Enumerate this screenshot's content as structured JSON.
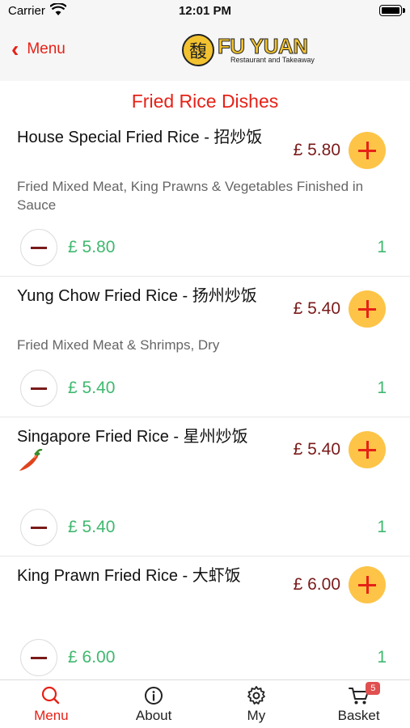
{
  "status_bar": {
    "carrier": "Carrier",
    "time": "12:01 PM"
  },
  "navbar": {
    "back_label": "Menu",
    "logo_name": "FU YUAN",
    "logo_subtitle": "Restaurant and Takeaway",
    "logo_glyph": "馥"
  },
  "section_title": "Fried Rice Dishes",
  "items": [
    {
      "name": "House Special Fried Rice - 招炒饭",
      "description": "Fried Mixed Meat, King Prawns & Vegetables Finished in Sauce",
      "price": "£ 5.80",
      "line_price": "£ 5.80",
      "quantity": "1",
      "spicy": false
    },
    {
      "name": "Yung Chow Fried Rice - 扬州炒饭",
      "description": "Fried Mixed Meat & Shrimps, Dry",
      "price": "£ 5.40",
      "line_price": "£ 5.40",
      "quantity": "1",
      "spicy": false
    },
    {
      "name": "Singapore Fried Rice - 星州炒饭",
      "description": "",
      "price": "£ 5.40",
      "line_price": "£ 5.40",
      "quantity": "1",
      "spicy": true
    },
    {
      "name": "King Prawn Fried Rice - 大虾饭",
      "description": "",
      "price": "£ 6.00",
      "line_price": "£ 6.00",
      "quantity": "1",
      "spicy": false
    }
  ],
  "tabbar": {
    "tabs": [
      {
        "label": "Menu",
        "icon": "search-icon",
        "active": true
      },
      {
        "label": "About",
        "icon": "info-icon",
        "active": false
      },
      {
        "label": "My",
        "icon": "gear-icon",
        "active": false
      },
      {
        "label": "Basket",
        "icon": "cart-icon",
        "active": false
      }
    ],
    "basket_count": "5"
  },
  "colors": {
    "accent": "#e62117",
    "add_button": "#fdc448",
    "price": "#7a1a1a",
    "green": "#3fb96f"
  }
}
